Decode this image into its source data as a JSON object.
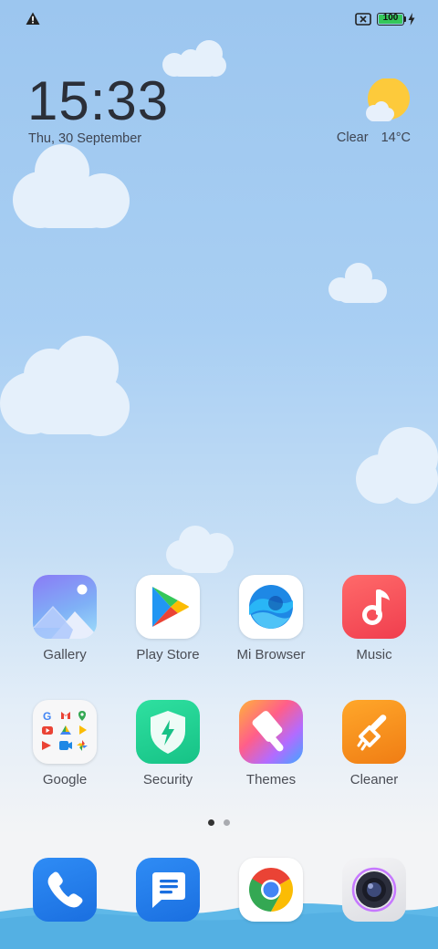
{
  "status_bar": {
    "icons": [
      "alert-icon",
      "no-sim-icon",
      "battery-icon",
      "charging-icon"
    ],
    "battery_level": "100",
    "battery_fraction": 1.0,
    "battery_color": "#35c75a"
  },
  "clock": {
    "time": "15:33",
    "date": "Thu, 30 September"
  },
  "weather": {
    "icon": "partly-cloudy-sun-icon",
    "condition": "Clear",
    "temperature": "14°C"
  },
  "apps": [
    {
      "label": "Gallery",
      "icon": "gallery-icon"
    },
    {
      "label": "Play Store",
      "icon": "play-store-icon"
    },
    {
      "label": "Mi Browser",
      "icon": "mi-browser-icon"
    },
    {
      "label": "Music",
      "icon": "music-icon"
    },
    {
      "label": "Google",
      "icon": "google-folder-icon"
    },
    {
      "label": "Security",
      "icon": "security-icon"
    },
    {
      "label": "Themes",
      "icon": "themes-icon"
    },
    {
      "label": "Cleaner",
      "icon": "cleaner-icon"
    }
  ],
  "pager": {
    "pages": 2,
    "active": 0,
    "active_color": "#333333",
    "inactive_color": "#a9abb0"
  },
  "dock": [
    {
      "icon": "phone-icon"
    },
    {
      "icon": "messaging-icon"
    },
    {
      "icon": "chrome-icon"
    },
    {
      "icon": "camera-icon"
    }
  ]
}
